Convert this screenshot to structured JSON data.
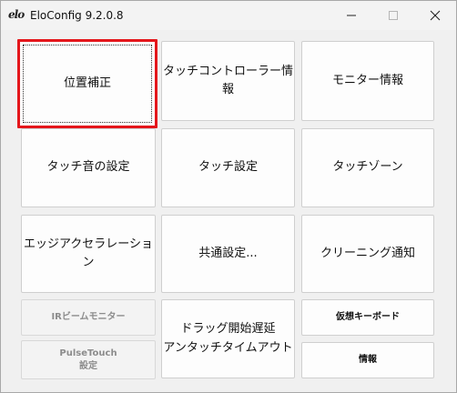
{
  "window": {
    "logo": "elo",
    "title": "EloConfig 9.2.0.8"
  },
  "buttons": {
    "calibration": "位置補正",
    "controller_info": "タッチコントローラー情報",
    "monitor_info": "モニター情報",
    "touch_sound": "タッチ音の設定",
    "touch_settings": "タッチ設定",
    "touch_zone": "タッチゾーン",
    "edge_acceleration": "エッジアクセラレーション",
    "common_settings": "共通設定...",
    "cleaning_notice": "クリーニング通知",
    "ir_beam_monitor": "IRビームモニター",
    "pulsetouch_line1": "PulseTouch",
    "pulsetouch_line2": "設定",
    "drag_line1": "ドラッグ開始遅延",
    "drag_line2": "アンタッチタイムアウト",
    "virtual_keyboard": "仮想キーボード",
    "info": "情報"
  },
  "colors": {
    "focus_border": "#e4161b",
    "background": "#f0f0f0"
  },
  "icons": {
    "minimize": "minimize-icon",
    "maximize": "maximize-icon",
    "close": "close-icon"
  }
}
